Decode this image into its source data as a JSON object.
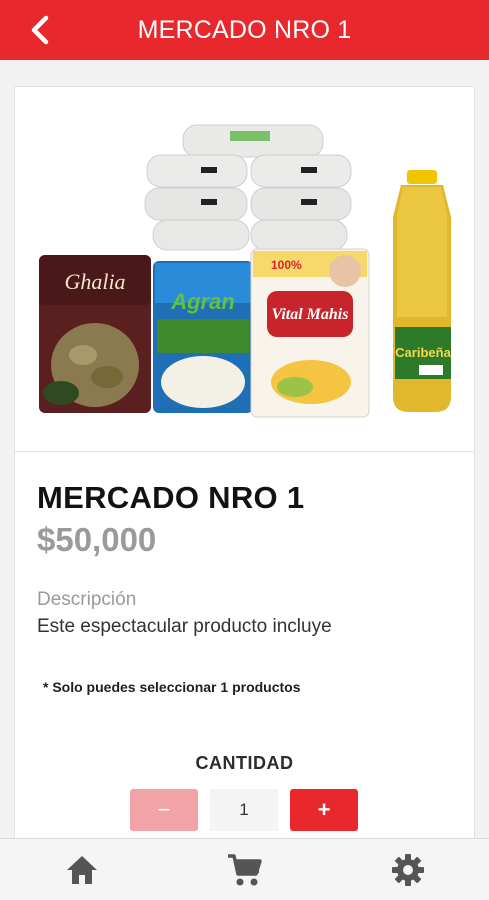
{
  "header": {
    "title": "MERCADO NRO 1",
    "back_icon": "chevron-left-icon"
  },
  "product": {
    "title": "MERCADO NRO 1",
    "price": "$50,000",
    "description_label": "Descripción",
    "description": "Este espectacular producto incluye",
    "note": "* Solo puedes seleccionar 1 productos",
    "image_brands": {
      "beans": "Ghalia",
      "rice": "Agran",
      "flour": "Vital Mahis",
      "flour_badge": "100%",
      "oil": "Caribeña"
    }
  },
  "quantity": {
    "label": "CANTIDAD",
    "minus": "−",
    "value": "1",
    "plus": "+"
  },
  "bottom_nav": [
    {
      "icon": "home-icon"
    },
    {
      "icon": "cart-icon"
    },
    {
      "icon": "settings-icon"
    }
  ],
  "colors": {
    "accent": "#e8282d",
    "accent_light": "#f2a3a5",
    "price_gray": "#9a9a9a"
  }
}
